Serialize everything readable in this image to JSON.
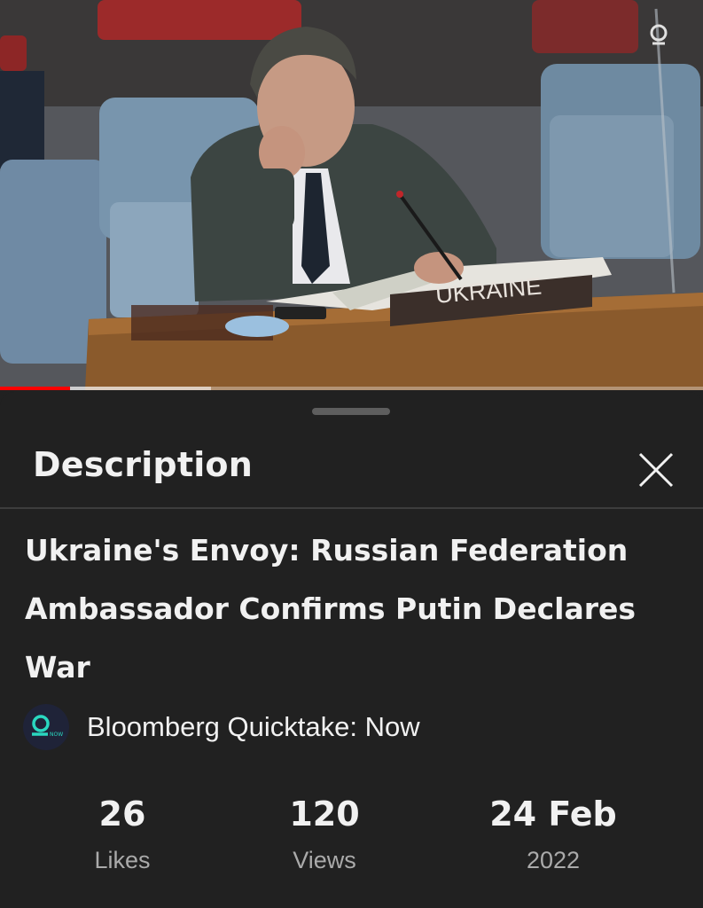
{
  "video": {
    "nameplate_text": "UKRAINE",
    "progress_played_fraction": 0.1,
    "progress_buffered_fraction": 0.3
  },
  "sheet": {
    "title": "Description",
    "close_icon": "close-icon"
  },
  "details": {
    "title": "Ukraine's Envoy: Russian Federation Ambassador Confirms Putin Declares War",
    "channel": {
      "name": "Bloomberg Quicktake: Now",
      "avatar_icon": "quicktake-now-logo"
    },
    "stats": [
      {
        "value": "26",
        "label": "Likes"
      },
      {
        "value": "120",
        "label": "Views"
      },
      {
        "value": "24 Feb",
        "label": "2022"
      }
    ]
  },
  "colors": {
    "background": "#212121",
    "text_primary": "#f1f1f1",
    "text_secondary": "#aaaaaa",
    "progress_red": "#ff0000",
    "avatar_teal": "#2ad7c0"
  }
}
